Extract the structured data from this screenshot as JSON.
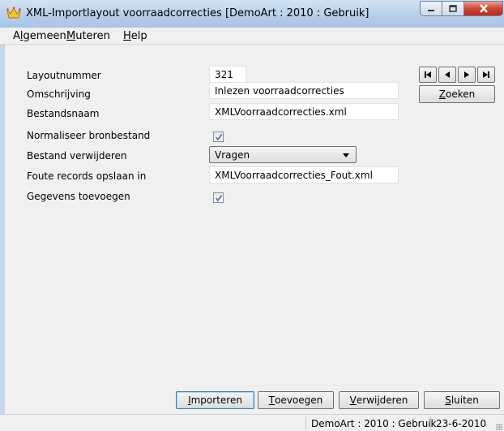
{
  "window": {
    "title": "XML-Importlayout voorraadcorrecties  [DemoArt : 2010 : Gebruik]"
  },
  "menu": {
    "items": [
      {
        "pre": "A",
        "key": "l",
        "post": "gemeen"
      },
      {
        "pre": "",
        "key": "M",
        "post": "uteren"
      },
      {
        "pre": "",
        "key": "H",
        "post": "elp"
      }
    ]
  },
  "form": {
    "layoutnummer": {
      "label": "Layoutnummer",
      "value": "321"
    },
    "omschrijving": {
      "label": "Omschrijving",
      "value": "Inlezen voorraadcorrecties"
    },
    "bestandsnaam": {
      "label": "Bestandsnaam",
      "value": "XMLVoorraadcorrecties.xml"
    },
    "normaliseer": {
      "label": "Normaliseer bronbestand",
      "checked": true
    },
    "verwijderen": {
      "label": "Bestand verwijderen",
      "value": "Vragen"
    },
    "foute": {
      "label": "Foute records opslaan in",
      "value": "XMLVoorraadcorrecties_Fout.xml"
    },
    "toevoegen": {
      "label": "Gegevens toevoegen",
      "checked": true
    }
  },
  "search": {
    "key": "Z",
    "rest": "oeken"
  },
  "buttons": {
    "importeren": {
      "key": "I",
      "rest": "mporteren"
    },
    "toevoegen": {
      "key": "T",
      "rest": "oevoegen"
    },
    "verwijderen": {
      "key": "V",
      "rest": "erwijderen"
    },
    "sluiten": {
      "key": "S",
      "rest": "luiten"
    }
  },
  "status": {
    "context": "DemoArt : 2010 : Gebruik",
    "date": "23-6-2010"
  }
}
